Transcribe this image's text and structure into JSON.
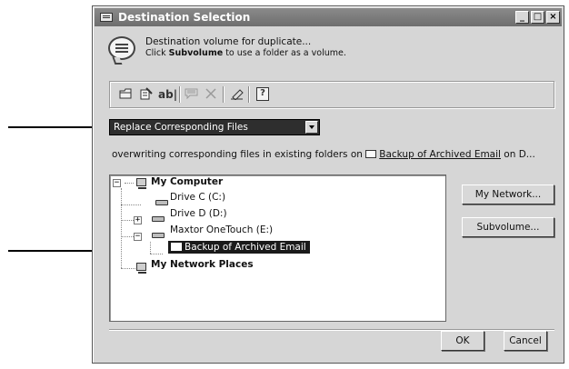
{
  "window": {
    "title": "Destination Selection",
    "controls": [
      "_",
      "□",
      "×"
    ]
  },
  "info": {
    "line1": "Destination volume for duplicate...",
    "line2_before": "Click ",
    "line2_bold": "Subvolume",
    "line2_after": " to use a folder as a volume."
  },
  "toolbar": {
    "items": [
      "new-folder-icon",
      "properties-icon",
      "rename-icon",
      "comment-icon",
      "delete-icon",
      "erase-icon",
      "help-icon"
    ],
    "rename_label": "ab|",
    "help_label": "?"
  },
  "dropdown": {
    "selected": "Replace Corresponding Files"
  },
  "overwrite": {
    "prefix": "overwriting corresponding files in existing folders on ",
    "target": "Backup of Archived Email",
    "suffix": " on D..."
  },
  "tree": {
    "my_computer": "My Computer",
    "drive_c": "Drive C (C:)",
    "drive_d": "Drive D (D:)",
    "maxtor": "Maxtor OneTouch (E:)",
    "backup": "Backup of Archived Email",
    "network": "My Network Places",
    "collapse_symbol": "−",
    "expand_symbol": "+"
  },
  "buttons": {
    "my_network": "My Network...",
    "subvolume": "Subvolume...",
    "ok": "OK",
    "cancel": "Cancel"
  },
  "colors": {
    "titlebar": "#7a7a7a",
    "selection": "#1a1a1a",
    "window": "#d6d6d6"
  }
}
